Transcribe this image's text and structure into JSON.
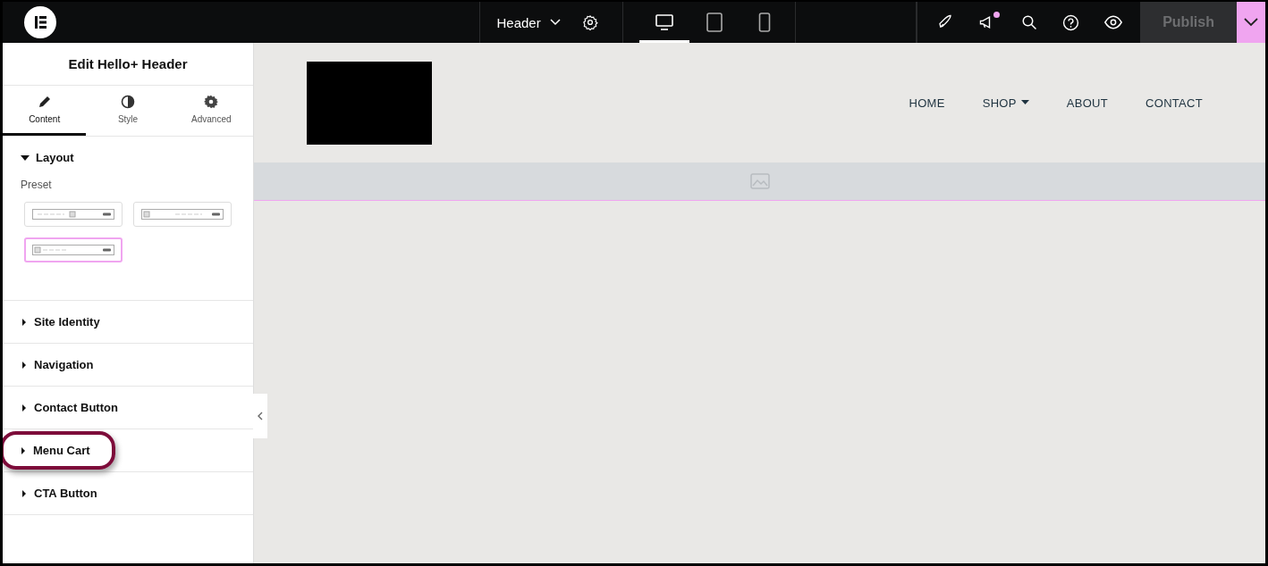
{
  "topbar": {
    "document": "Header",
    "devices": [
      {
        "kind": "desktop",
        "selected": true
      },
      {
        "kind": "tablet",
        "selected": false
      },
      {
        "kind": "mobile",
        "selected": false
      }
    ],
    "notification": true,
    "publish": {
      "label": "Publish",
      "disabled": true
    }
  },
  "panel": {
    "title": "Edit Hello+ Header",
    "tabs": [
      {
        "kind": "content",
        "label": "Content",
        "selected": true
      },
      {
        "kind": "style",
        "label": "Style",
        "selected": false
      },
      {
        "kind": "advanced",
        "label": "Advanced",
        "selected": false
      }
    ],
    "sections": [
      {
        "title": "Layout",
        "expanded": true,
        "highlighted": false,
        "preset_label": "Preset",
        "presets": [
          {
            "kind": "center",
            "selected": false
          },
          {
            "kind": "right",
            "selected": false
          },
          {
            "kind": "left",
            "selected": true
          }
        ]
      },
      {
        "title": "Site Identity",
        "expanded": false,
        "highlighted": false
      },
      {
        "title": "Navigation",
        "expanded": false,
        "highlighted": false
      },
      {
        "title": "Contact Button",
        "expanded": false,
        "highlighted": false
      },
      {
        "title": "Menu Cart",
        "expanded": false,
        "highlighted": true
      },
      {
        "title": "CTA Button",
        "expanded": false,
        "highlighted": false
      }
    ]
  },
  "canvas": {
    "nav": [
      {
        "label": "HOME",
        "dropdown": false
      },
      {
        "label": "SHOP",
        "dropdown": true
      },
      {
        "label": "ABOUT",
        "dropdown": false
      },
      {
        "label": "CONTACT",
        "dropdown": false
      }
    ]
  }
}
